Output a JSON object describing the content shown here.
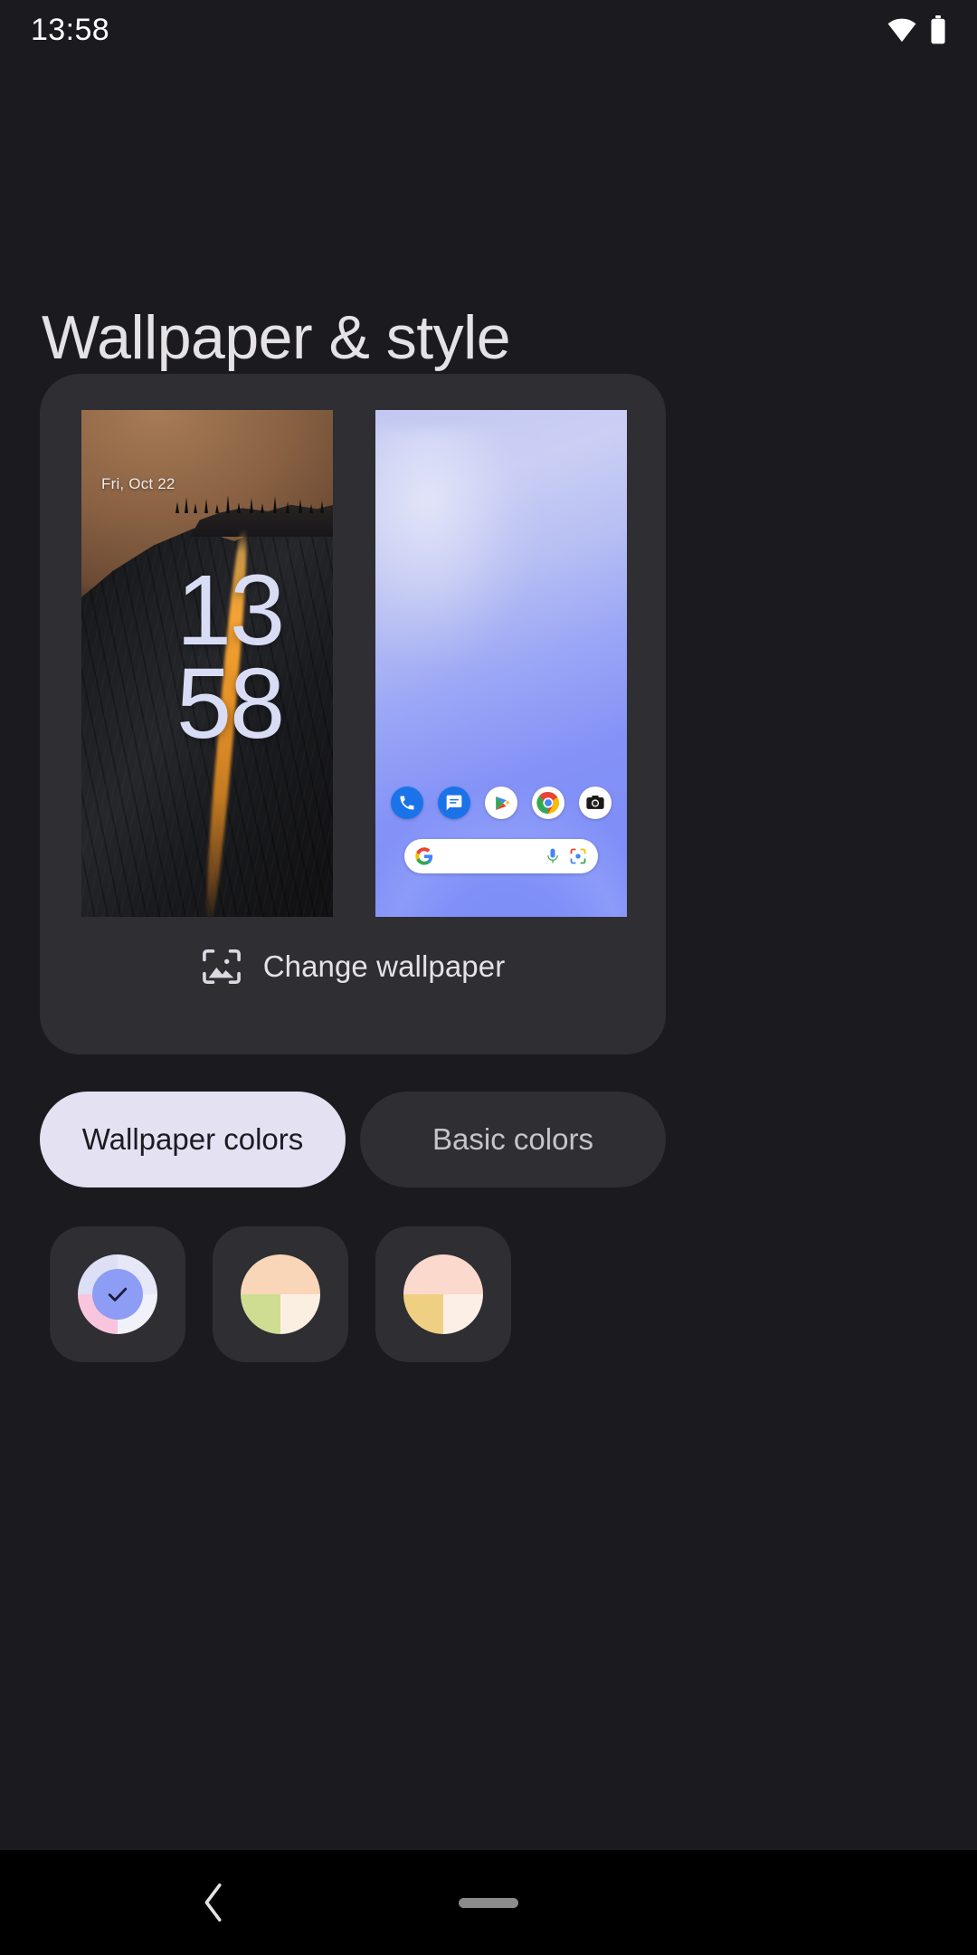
{
  "status_bar": {
    "time": "13:58",
    "wifi_icon": "wifi-icon",
    "battery_icon": "battery-icon"
  },
  "header": {
    "title": "Wallpaper & style"
  },
  "preview_card": {
    "lock_screen": {
      "name": "lock-screen-preview",
      "date": "Fri, Oct 22",
      "clock_hours": "13",
      "clock_minutes": "58",
      "wallpaper_description": "Horsetail Fall firefall cliff at dusk"
    },
    "home_screen": {
      "name": "home-screen-preview",
      "wallpaper_description": "Blue periwinkle gradient",
      "dock_apps": [
        {
          "name": "phone-icon",
          "label": "Phone"
        },
        {
          "name": "messages-icon",
          "label": "Messages"
        },
        {
          "name": "play-store-icon",
          "label": "Play Store"
        },
        {
          "name": "chrome-icon",
          "label": "Chrome"
        },
        {
          "name": "camera-icon",
          "label": "Camera"
        }
      ],
      "search_bar": {
        "google_logo": "google-g-icon",
        "mic_icon": "microphone-icon",
        "lens_icon": "google-lens-icon"
      }
    },
    "change_wallpaper": {
      "label": "Change wallpaper",
      "icon": "image-picker-icon"
    }
  },
  "color_tabs": [
    {
      "label": "Wallpaper colors",
      "selected": true
    },
    {
      "label": "Basic colors",
      "selected": false
    }
  ],
  "color_swatches": [
    {
      "name": "color-swatch-1",
      "selected": true,
      "center": "#8D9CF4",
      "check_color": "#1B1B35",
      "quadrants": [
        "#DDDFF6",
        "#E6E7F7",
        "#F9C4DE",
        "#F1F1FA"
      ]
    },
    {
      "name": "color-swatch-2",
      "selected": false,
      "center": null,
      "quadrants": [
        "#FAD6B8",
        "#FAD6B8",
        "#CEDD92",
        "#FBEFE2"
      ]
    },
    {
      "name": "color-swatch-3",
      "selected": false,
      "center": null,
      "quadrants": [
        "#FBD9CD",
        "#FBD9CD",
        "#EFD083",
        "#FCEFE6"
      ]
    }
  ],
  "nav_bar": {
    "back_icon": "back-chevron-icon",
    "home_pill": "home-pill-handle"
  },
  "colors": {
    "background": "#1B1B1F",
    "card": "#2E2E33",
    "tab_selected_bg": "#E4E1F2",
    "tab_selected_text": "#1B1B21",
    "tab_unselected_bg": "#2F2F33",
    "tab_unselected_text": "#C6C4C8",
    "title_text": "#E5E2E6"
  }
}
